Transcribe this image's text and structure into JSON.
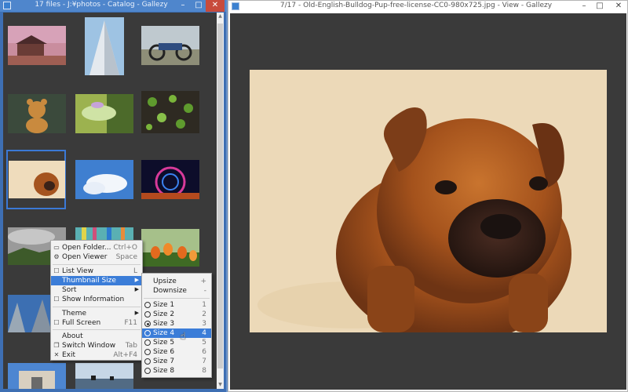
{
  "catalog_window": {
    "title": "17 files - J:¥photos - Catalog - Gallezy",
    "minimize": "–",
    "maximize": "□",
    "close": "✕"
  },
  "viewer_window": {
    "title": "7/17 - Old-English-Bulldog-Pup-free-license-CC0-980x725.jpg - View - Gallezy",
    "minimize": "–",
    "maximize": "□",
    "close": "✕"
  },
  "thumbnails": [
    {
      "subject": "house-at-sunset"
    },
    {
      "subject": "tall-building"
    },
    {
      "subject": "motorcycle"
    },
    {
      "subject": "teddy-bear"
    },
    {
      "subject": "frog"
    },
    {
      "subject": "green-leaves"
    },
    {
      "subject": "puppy",
      "selected": true
    },
    {
      "subject": "sky-clouds"
    },
    {
      "subject": "ferris-wheel-night"
    },
    {
      "subject": "hills-cloudy"
    },
    {
      "subject": "colorful-ribbons"
    },
    {
      "subject": "tulips"
    },
    {
      "subject": "building-from-below"
    },
    {
      "subject": "arch-monument"
    },
    {
      "subject": "lake-silhouette"
    }
  ],
  "context_menu": {
    "items": [
      {
        "label": "Open Folder...",
        "shortcut": "Ctrl+O",
        "icon": "folder-icon"
      },
      {
        "label": "Open Viewer",
        "shortcut": "Space",
        "icon": "gear-icon"
      },
      {
        "label": "List View",
        "shortcut": "L",
        "icon": "checkbox-icon"
      },
      {
        "label": "Thumbnail Size",
        "shortcut": "",
        "submenu": true
      },
      {
        "label": "Sort",
        "shortcut": "",
        "submenu": true
      },
      {
        "label": "Show Information",
        "shortcut": "",
        "icon": "checkbox-icon"
      },
      {
        "label": "Theme",
        "shortcut": "",
        "submenu": true
      },
      {
        "label": "Full Screen",
        "shortcut": "F11",
        "icon": "checkbox-icon"
      },
      {
        "label": "About",
        "shortcut": ""
      },
      {
        "label": "Switch Window",
        "shortcut": "Tab",
        "icon": "window-icon"
      },
      {
        "label": "Exit",
        "shortcut": "Alt+F4",
        "icon": "close-icon"
      }
    ]
  },
  "submenu": {
    "upsize": {
      "label": "Upsize",
      "shortcut": "+"
    },
    "downsize": {
      "label": "Downsize",
      "shortcut": "-"
    },
    "sizes": [
      {
        "label": "Size 1",
        "shortcut": "1"
      },
      {
        "label": "Size 2",
        "shortcut": "2"
      },
      {
        "label": "Size 3",
        "shortcut": "3",
        "checked": true
      },
      {
        "label": "Size 4",
        "shortcut": "4"
      },
      {
        "label": "Size 5",
        "shortcut": "5"
      },
      {
        "label": "Size 6",
        "shortcut": "6"
      },
      {
        "label": "Size 7",
        "shortcut": "7"
      },
      {
        "label": "Size 8",
        "shortcut": "8"
      }
    ]
  },
  "colors": {
    "accent": "#3b7dd8",
    "content_bg": "#3a3a3a",
    "title_bar_active": "#4f86cc"
  }
}
